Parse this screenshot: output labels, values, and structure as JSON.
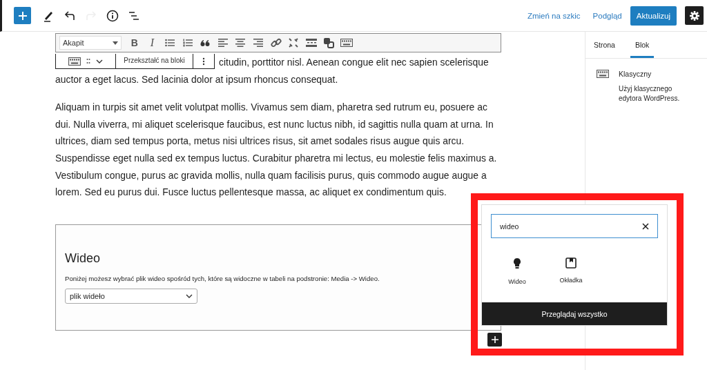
{
  "top_toolbar": {
    "tools": [
      {
        "kind": "add",
        "disabled": false
      },
      {
        "kind": "edit",
        "disabled": false
      },
      {
        "kind": "undo",
        "disabled": false
      },
      {
        "kind": "redo",
        "disabled": true
      },
      {
        "kind": "info",
        "disabled": false
      },
      {
        "kind": "outline",
        "disabled": false
      }
    ],
    "actions": [
      {
        "kind": "link",
        "label": "Zmień na szkic"
      },
      {
        "kind": "link",
        "label": "Podgląd"
      },
      {
        "kind": "primary",
        "label": "Aktualizuj"
      }
    ],
    "settings": {
      "selected": true
    }
  },
  "classic_toolbar": {
    "format": "Akapit",
    "buttons": [
      {
        "kind": "text",
        "label": "B"
      },
      {
        "kind": "italic",
        "label": "I"
      },
      {
        "kind": "bullet-list"
      },
      {
        "kind": "numbered-list"
      },
      {
        "kind": "quote"
      },
      {
        "kind": "align-left"
      },
      {
        "kind": "align-center"
      },
      {
        "kind": "align-right"
      },
      {
        "kind": "link"
      },
      {
        "kind": "unlink"
      },
      {
        "kind": "read-more"
      },
      {
        "kind": "toolbar-toggle"
      },
      {
        "kind": "keyboard"
      }
    ]
  },
  "block_toolbar": {
    "label": "Przekształć na bloki"
  },
  "paragraphs": [
    "citudin, porttitor nisl. Aenean congue elit nec sapien scelerisque auctor a eget lacus. Sed lacinia dolor at ipsum rhoncus consequat.",
    "Aliquam in turpis sit amet velit volutpat mollis. Vivamus sem diam, pharetra sed rutrum eu, posuere ac dui. Nulla viverra, mi aliquet scelerisque faucibus, est nunc luctus nibh, id sagittis nulla quam at urna. In ultrices, diam sed tempus porta, metus nisi ultrices risus, sit amet sodales risus augue quis arcu. Suspendisse eget nulla sed ex tempus luctus. Curabitur pharetra mi lectus, eu molestie felis maximus a. Vestibulum congue, purus ac gravida mollis, nulla quam facilisis purus, quis commodo augue augue a lorem. Sed eu purus dui. Fusce luctus pellentesque massa, ac aliquet ex condimentum quis."
  ],
  "video_block": {
    "title": "Wideo",
    "description": "Poniżej możesz wybrać plik wideo spośród tych, które są widoczne w tabeli na podstronie: Media -> Wideo.",
    "select": "plik wideło"
  },
  "sidebar": {
    "tabs": [
      {
        "label": "Strona",
        "selected": false
      },
      {
        "label": "Blok",
        "selected": true
      }
    ],
    "block": {
      "name": "Klasyczny",
      "description": "Użyj klasycznego edytora WordPress."
    }
  },
  "inserter": {
    "search": "wideo",
    "results": [
      {
        "kind": "bulb",
        "label": "Wideo"
      },
      {
        "kind": "cover",
        "label": "Okładka"
      }
    ],
    "browse_all": "Przeglądaj wszystko"
  }
}
